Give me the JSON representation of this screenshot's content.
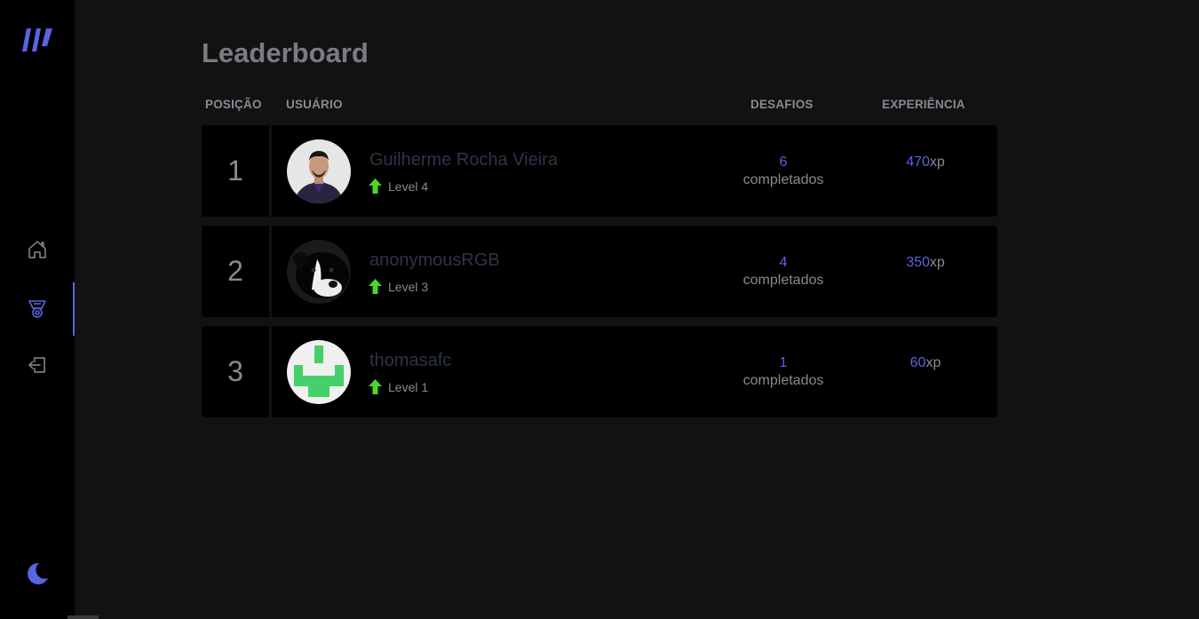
{
  "page": {
    "title": "Leaderboard"
  },
  "table": {
    "headers": {
      "position": "POSIÇÃO",
      "user": "USUÁRIO",
      "challenges": "DESAFIOS",
      "experience": "EXPERIÊNCIA"
    },
    "rows": [
      {
        "rank": "1",
        "name": "Guilherme Rocha Vieira",
        "level": "Level 4",
        "challenges": "6",
        "challenges_label": "completados",
        "xp": "470",
        "xp_unit": "xp"
      },
      {
        "rank": "2",
        "name": "anonymousRGB",
        "level": "Level 3",
        "challenges": "4",
        "challenges_label": "completados",
        "xp": "350",
        "xp_unit": "xp"
      },
      {
        "rank": "3",
        "name": "thomasafc",
        "level": "Level 1",
        "challenges": "1",
        "challenges_label": "completados",
        "xp": "60",
        "xp_unit": "xp"
      }
    ]
  },
  "sidebar": {
    "items": [
      {
        "icon": "home-icon",
        "active": false
      },
      {
        "icon": "medal-icon",
        "active": true
      },
      {
        "icon": "logout-icon",
        "active": false
      }
    ],
    "theme_icon": "moon-icon"
  },
  "colors": {
    "accent": "#5965e0",
    "level_up": "#4cd62b",
    "background": "#121214",
    "card": "#000000"
  }
}
